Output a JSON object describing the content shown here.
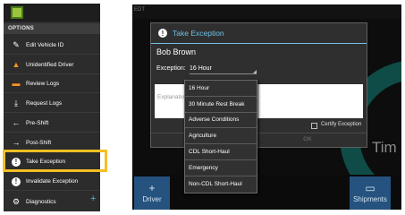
{
  "menu": {
    "header": "OPTIONS",
    "items": [
      {
        "label": "Edit Vehicle ID",
        "icon": "pencil-icon"
      },
      {
        "label": "Unidentified Driver",
        "icon": "warning-icon"
      },
      {
        "label": "Review Logs",
        "icon": "review-logs-icon"
      },
      {
        "label": "Request Logs",
        "icon": "download-icon"
      },
      {
        "label": "Pre-Shift",
        "icon": "arrow-left-icon"
      },
      {
        "label": "Post-Shift",
        "icon": "arrow-right-icon"
      },
      {
        "label": "Take Exception",
        "icon": "exclamation-icon"
      },
      {
        "label": "Invalidate Exception",
        "icon": "exclamation-icon"
      },
      {
        "label": "Diagnostics",
        "icon": "gear-icon"
      }
    ],
    "highlighted_item": "Take Exception",
    "highlight_color": "#f3bf24"
  },
  "background": {
    "top_label": "EDT",
    "partial_label": "Tim",
    "nav": [
      {
        "label": "Driver",
        "icon": "plus-icon"
      },
      {
        "label": "Shipments",
        "icon": "clipboard-icon"
      }
    ]
  },
  "dialog": {
    "title": "Take Exception",
    "driver_name": "Bob Brown",
    "exception_label": "Exception:",
    "exception_value": "16 Hour",
    "explanation_placeholder": "Explanation",
    "certify_label": "Certify Exception",
    "ok_label": "OK",
    "accent_color": "#6fc1e5"
  },
  "dropdown": {
    "options": [
      "16 Hour",
      "30 Minute Rest Break",
      "Adverse Conditions",
      "Agriculture",
      "CDL Short-Haul",
      "Emergency",
      "Non-CDL Short-Haul"
    ]
  }
}
